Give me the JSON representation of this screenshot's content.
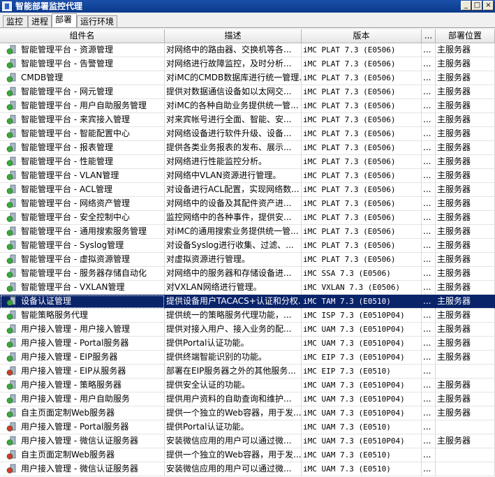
{
  "window": {
    "title": "智能部署监控代理",
    "buttons": {
      "minimize": "_",
      "maximize": "□",
      "close": "×"
    }
  },
  "tabs": [
    {
      "label": "监控",
      "active": false
    },
    {
      "label": "进程",
      "active": false
    },
    {
      "label": "部署",
      "active": true
    },
    {
      "label": "运行环境",
      "active": false
    }
  ],
  "table": {
    "columns": [
      "组件名",
      "描述",
      "版本",
      "...",
      "部署位置"
    ],
    "rows": [
      {
        "icon": "green",
        "name": "智能管理平台 - 资源管理",
        "desc": "对网络中的路由器、交换机等各...",
        "version": "iMC PLAT 7.3 (E0506)",
        "extra": "...",
        "location": "主服务器",
        "selected": false
      },
      {
        "icon": "green",
        "name": "智能管理平台 - 告警管理",
        "desc": "对网络进行故障监控，及时分析...",
        "version": "iMC PLAT 7.3 (E0506)",
        "extra": "...",
        "location": "主服务器",
        "selected": false
      },
      {
        "icon": "green",
        "name": "CMDB管理",
        "desc": "对iMC的CMDB数据库进行统一管理...",
        "version": "iMC PLAT 7.3 (E0506)",
        "extra": "...",
        "location": "主服务器",
        "selected": false
      },
      {
        "icon": "green",
        "name": "智能管理平台 - 网元管理",
        "desc": "提供对数据通信设备如以太网交...",
        "version": "iMC PLAT 7.3 (E0506)",
        "extra": "...",
        "location": "主服务器",
        "selected": false
      },
      {
        "icon": "green",
        "name": "智能管理平台 - 用户自助服务管理",
        "desc": "对iMC的各种自助业务提供统一管...",
        "version": "iMC PLAT 7.3 (E0506)",
        "extra": "...",
        "location": "主服务器",
        "selected": false
      },
      {
        "icon": "green",
        "name": "智能管理平台 - 来宾接入管理",
        "desc": "对来宾帐号进行全面、智能、安...",
        "version": "iMC PLAT 7.3 (E0506)",
        "extra": "...",
        "location": "主服务器",
        "selected": false
      },
      {
        "icon": "green",
        "name": "智能管理平台 - 智能配置中心",
        "desc": "对网络设备进行软件升级、设备...",
        "version": "iMC PLAT 7.3 (E0506)",
        "extra": "...",
        "location": "主服务器",
        "selected": false
      },
      {
        "icon": "green",
        "name": "智能管理平台 - 报表管理",
        "desc": "提供各类业务报表的发布、展示...",
        "version": "iMC PLAT 7.3 (E0506)",
        "extra": "...",
        "location": "主服务器",
        "selected": false
      },
      {
        "icon": "green",
        "name": "智能管理平台 - 性能管理",
        "desc": "对网络进行性能监控分析。",
        "version": "iMC PLAT 7.3 (E0506)",
        "extra": "...",
        "location": "主服务器",
        "selected": false
      },
      {
        "icon": "green",
        "name": "智能管理平台 - VLAN管理",
        "desc": "对网络中VLAN资源进行管理。",
        "version": "iMC PLAT 7.3 (E0506)",
        "extra": "...",
        "location": "主服务器",
        "selected": false
      },
      {
        "icon": "green",
        "name": "智能管理平台 - ACL管理",
        "desc": "对设备进行ACL配置，实现网络数...",
        "version": "iMC PLAT 7.3 (E0506)",
        "extra": "...",
        "location": "主服务器",
        "selected": false
      },
      {
        "icon": "green",
        "name": "智能管理平台 - 网络资产管理",
        "desc": "对网络中的设备及其配件资产进...",
        "version": "iMC PLAT 7.3 (E0506)",
        "extra": "...",
        "location": "主服务器",
        "selected": false
      },
      {
        "icon": "green",
        "name": "智能管理平台 - 安全控制中心",
        "desc": "监控网络中的各种事件，提供安...",
        "version": "iMC PLAT 7.3 (E0506)",
        "extra": "...",
        "location": "主服务器",
        "selected": false
      },
      {
        "icon": "green",
        "name": "智能管理平台 - 通用搜索服务管理",
        "desc": "对iMC的通用搜索业务提供统一管...",
        "version": "iMC PLAT 7.3 (E0506)",
        "extra": "...",
        "location": "主服务器",
        "selected": false
      },
      {
        "icon": "green",
        "name": "智能管理平台 - Syslog管理",
        "desc": "对设备Syslog进行收集、过滤、...",
        "version": "iMC PLAT 7.3 (E0506)",
        "extra": "...",
        "location": "主服务器",
        "selected": false
      },
      {
        "icon": "green",
        "name": "智能管理平台 - 虚拟资源管理",
        "desc": "对虚拟资源进行管理。",
        "version": "iMC PLAT 7.3 (E0506)",
        "extra": "...",
        "location": "主服务器",
        "selected": false
      },
      {
        "icon": "green",
        "name": "智能管理平台 - 服务器存储自动化",
        "desc": "对网络中的服务器和存储设备进...",
        "version": "iMC SSA 7.3 (E0506)",
        "extra": "...",
        "location": "主服务器",
        "selected": false
      },
      {
        "icon": "green",
        "name": "智能管理平台 - VXLAN管理",
        "desc": "对VXLAN网络进行管理。",
        "version": "iMC VXLAN 7.3 (E0506)",
        "extra": "...",
        "location": "主服务器",
        "selected": false
      },
      {
        "icon": "green",
        "name": "设备认证管理",
        "desc": "提供设备用户TACACS+认证和分权...",
        "version": "iMC TAM 7.3 (E0510)",
        "extra": "...",
        "location": "主服务器",
        "selected": true
      },
      {
        "icon": "green",
        "name": "智能策略服务代理",
        "desc": "提供统一的策略服务代理功能，...",
        "version": "iMC ISP 7.3 (E0510P04)",
        "extra": "...",
        "location": "主服务器",
        "selected": false
      },
      {
        "icon": "green",
        "name": "用户接入管理 - 用户接入管理",
        "desc": "提供对接入用户、接入业务的配...",
        "version": "iMC UAM 7.3 (E0510P04)",
        "extra": "...",
        "location": "主服务器",
        "selected": false
      },
      {
        "icon": "green",
        "name": "用户接入管理 - Portal服务器",
        "desc": "提供Portal认证功能。",
        "version": "iMC UAM 7.3 (E0510P04)",
        "extra": "...",
        "location": "主服务器",
        "selected": false
      },
      {
        "icon": "green",
        "name": "用户接入管理 - EIP服务器",
        "desc": "提供终端智能识别的功能。",
        "version": "iMC EIP 7.3 (E0510P04)",
        "extra": "...",
        "location": "主服务器",
        "selected": false
      },
      {
        "icon": "red",
        "name": "用户接入管理 - EIP从服务器",
        "desc": "部署在EIP服务器之外的其他服务...",
        "version": "iMC EIP 7.3 (E0510)",
        "extra": "...",
        "location": "",
        "selected": false
      },
      {
        "icon": "green",
        "name": "用户接入管理 - 策略服务器",
        "desc": "提供安全认证的功能。",
        "version": "iMC UAM 7.3 (E0510P04)",
        "extra": "...",
        "location": "主服务器",
        "selected": false
      },
      {
        "icon": "green",
        "name": "用户接入管理 - 用户自助服务",
        "desc": "提供用户资料的自助查询和维护...",
        "version": "iMC UAM 7.3 (E0510P04)",
        "extra": "...",
        "location": "主服务器",
        "selected": false
      },
      {
        "icon": "green",
        "name": "自主页面定制Web服务器",
        "desc": "提供一个独立的Web容器，用于发...",
        "version": "iMC UAM 7.3 (E0510P04)",
        "extra": "...",
        "location": "主服务器",
        "selected": false
      },
      {
        "icon": "red",
        "name": "用户接入管理 - Portal服务器",
        "desc": "提供Portal认证功能。",
        "version": "iMC UAM 7.3 (E0510)",
        "extra": "...",
        "location": "",
        "selected": false
      },
      {
        "icon": "green",
        "name": "用户接入管理 - 微信认证服务器",
        "desc": "安装微信应用的用户可以通过微...",
        "version": "iMC UAM 7.3 (E0510P04)",
        "extra": "...",
        "location": "主服务器",
        "selected": false
      },
      {
        "icon": "red",
        "name": "自主页面定制Web服务器",
        "desc": "提供一个独立的Web容器，用于发...",
        "version": "iMC UAM 7.3 (E0510)",
        "extra": "...",
        "location": "",
        "selected": false
      },
      {
        "icon": "red",
        "name": "用户接入管理 - 微信认证服务器",
        "desc": "安装微信应用的用户可以通过微...",
        "version": "iMC UAM 7.3 (E0510)",
        "extra": "...",
        "location": "",
        "selected": false
      }
    ]
  },
  "icon_colors": {
    "green": "#3aa83a",
    "red": "#d23a2a",
    "server": "#a9b8c8",
    "selected_bg": "#0a246a"
  }
}
